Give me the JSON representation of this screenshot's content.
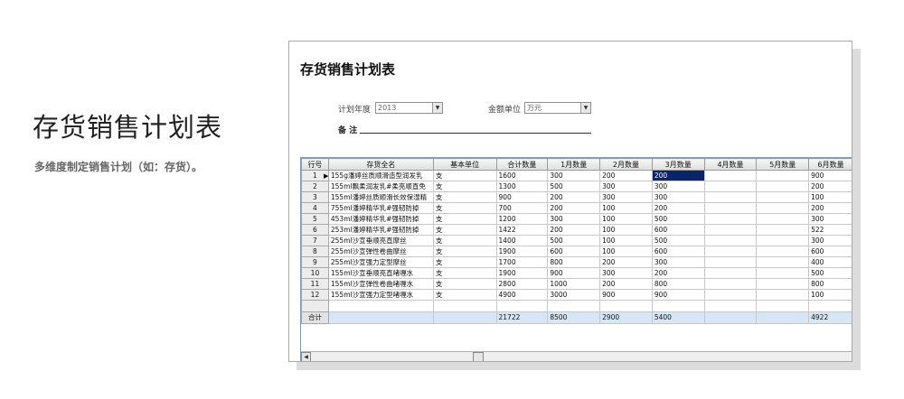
{
  "hero": {
    "title": "存货销售计划表",
    "subtitle": "多维度制定销售计划（如：存货）。"
  },
  "window": {
    "title": "存货销售计划表",
    "plan_year_label": "计划年度",
    "plan_year_value": "2013",
    "amount_unit_label": "金额单位",
    "amount_unit_value": "万元",
    "remark_label": "备  注"
  },
  "grid": {
    "columns": [
      "行号",
      "存货全名",
      "基本单位",
      "合计数量",
      "1月数量",
      "2月数量",
      "3月数量",
      "4月数量",
      "5月数量",
      "6月数量"
    ],
    "rows": [
      {
        "no": "1",
        "name": "155g潘婷丝质顺滑造型润发乳",
        "unit": "支",
        "total": "1600",
        "m1": "300",
        "m2": "200",
        "m3": "200",
        "m4": "",
        "m5": "",
        "m6": "900"
      },
      {
        "no": "2",
        "name": "155ml飘柔润发乳#柔亮顺直免",
        "unit": "支",
        "total": "1300",
        "m1": "500",
        "m2": "300",
        "m3": "300",
        "m4": "",
        "m5": "",
        "m6": "200"
      },
      {
        "no": "3",
        "name": "155ml潘婷丝质顺滑长效保湿精",
        "unit": "支",
        "total": "900",
        "m1": "200",
        "m2": "300",
        "m3": "300",
        "m4": "",
        "m5": "",
        "m6": "100"
      },
      {
        "no": "4",
        "name": "755ml潘婷精华乳#强韧防掉",
        "unit": "支",
        "total": "700",
        "m1": "200",
        "m2": "100",
        "m3": "200",
        "m4": "",
        "m5": "",
        "m6": "200"
      },
      {
        "no": "5",
        "name": "453ml潘婷精华乳#强韧防掉",
        "unit": "支",
        "total": "1200",
        "m1": "300",
        "m2": "100",
        "m3": "500",
        "m4": "",
        "m5": "",
        "m6": "300"
      },
      {
        "no": "6",
        "name": "253ml潘婷精华乳#强韧防掉",
        "unit": "支",
        "total": "1422",
        "m1": "200",
        "m2": "100",
        "m3": "600",
        "m4": "",
        "m5": "",
        "m6": "522"
      },
      {
        "no": "7",
        "name": "255ml沙宣垂顺亮直摩丝",
        "unit": "支",
        "total": "1400",
        "m1": "500",
        "m2": "100",
        "m3": "500",
        "m4": "",
        "m5": "",
        "m6": "300"
      },
      {
        "no": "8",
        "name": "255ml沙宣弹性卷曲摩丝",
        "unit": "支",
        "total": "1900",
        "m1": "600",
        "m2": "100",
        "m3": "600",
        "m4": "",
        "m5": "",
        "m6": "600"
      },
      {
        "no": "9",
        "name": "255ml沙宣强力定型摩丝",
        "unit": "支",
        "total": "1700",
        "m1": "800",
        "m2": "200",
        "m3": "300",
        "m4": "",
        "m5": "",
        "m6": "400"
      },
      {
        "no": "10",
        "name": "155ml沙宣垂顺亮直啫喱水",
        "unit": "支",
        "total": "1900",
        "m1": "900",
        "m2": "300",
        "m3": "200",
        "m4": "",
        "m5": "",
        "m6": "500"
      },
      {
        "no": "11",
        "name": "155ml沙宣弹性卷曲啫喱水",
        "unit": "支",
        "total": "2800",
        "m1": "1000",
        "m2": "200",
        "m3": "800",
        "m4": "",
        "m5": "",
        "m6": "800"
      },
      {
        "no": "12",
        "name": "155ml沙宣强力定型啫喱水",
        "unit": "支",
        "total": "4900",
        "m1": "3000",
        "m2": "900",
        "m3": "900",
        "m4": "",
        "m5": "",
        "m6": "100"
      }
    ],
    "total_row": {
      "label": "合计",
      "total": "21722",
      "m1": "8500",
      "m2": "2900",
      "m3": "5400",
      "m4": "",
      "m5": "",
      "m6": "4922"
    },
    "selected_cell": {
      "row": 0,
      "col": "m3"
    }
  }
}
